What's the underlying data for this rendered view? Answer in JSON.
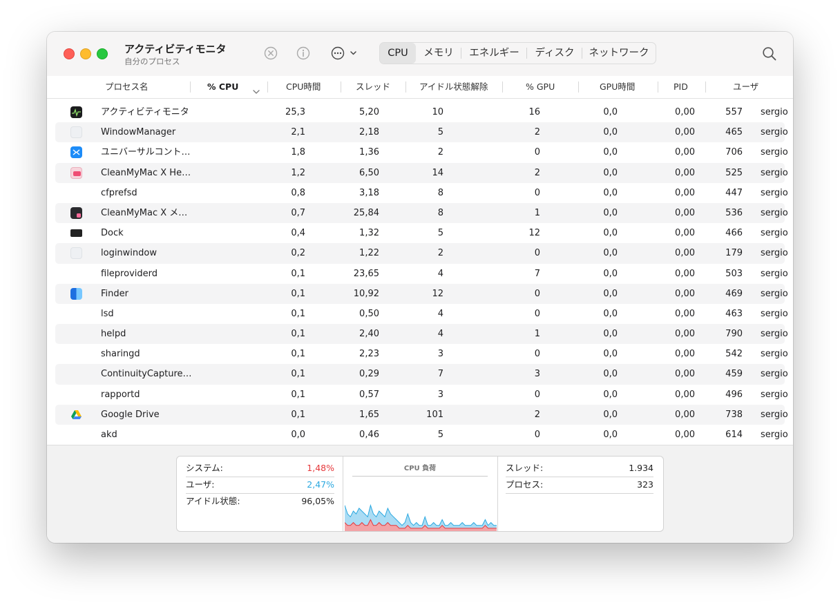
{
  "window": {
    "title": "アクティビティモニタ",
    "subtitle": "自分のプロセス"
  },
  "toolbar": {
    "icons": [
      "stop-process-icon",
      "info-icon",
      "more-actions-icon",
      "search-icon"
    ],
    "tabs": [
      {
        "label": "CPU",
        "active": true
      },
      {
        "label": "メモリ",
        "active": false
      },
      {
        "label": "エネルギー",
        "active": false
      },
      {
        "label": "ディスク",
        "active": false
      },
      {
        "label": "ネットワーク",
        "active": false
      }
    ]
  },
  "columns": [
    "プロセス名",
    "% CPU",
    "CPU時間",
    "スレッド",
    "アイドル状態解除",
    "% GPU",
    "GPU時間",
    "PID",
    "ユーザ"
  ],
  "processes": [
    {
      "name": "アクティビティモニタ",
      "icon": "activity-monitor-icon",
      "cpu": "25,3",
      "cpu_time": "5,20",
      "threads": "10",
      "idle_wakeups": "16",
      "gpu": "0,0",
      "gpu_time": "0,00",
      "pid": "557",
      "user": "sergio"
    },
    {
      "name": "WindowManager",
      "icon": "generic-app-icon",
      "cpu": "2,1",
      "cpu_time": "2,18",
      "threads": "5",
      "idle_wakeups": "2",
      "gpu": "0,0",
      "gpu_time": "0,00",
      "pid": "465",
      "user": "sergio"
    },
    {
      "name": "ユニバーサルコント…",
      "icon": "universal-control-icon",
      "cpu": "1,8",
      "cpu_time": "1,36",
      "threads": "2",
      "idle_wakeups": "0",
      "gpu": "0,0",
      "gpu_time": "0,00",
      "pid": "706",
      "user": "sergio"
    },
    {
      "name": "CleanMyMac X He…",
      "icon": "cleanmymac-health-icon",
      "cpu": "1,2",
      "cpu_time": "6,50",
      "threads": "14",
      "idle_wakeups": "2",
      "gpu": "0,0",
      "gpu_time": "0,00",
      "pid": "525",
      "user": "sergio"
    },
    {
      "name": "cfprefsd",
      "icon": "",
      "cpu": "0,8",
      "cpu_time": "3,18",
      "threads": "8",
      "idle_wakeups": "0",
      "gpu": "0,0",
      "gpu_time": "0,00",
      "pid": "447",
      "user": "sergio"
    },
    {
      "name": "CleanMyMac X メ…",
      "icon": "cleanmymac-menu-icon",
      "cpu": "0,7",
      "cpu_time": "25,84",
      "threads": "8",
      "idle_wakeups": "1",
      "gpu": "0,0",
      "gpu_time": "0,00",
      "pid": "536",
      "user": "sergio"
    },
    {
      "name": "Dock",
      "icon": "dock-icon",
      "cpu": "0,4",
      "cpu_time": "1,32",
      "threads": "5",
      "idle_wakeups": "12",
      "gpu": "0,0",
      "gpu_time": "0,00",
      "pid": "466",
      "user": "sergio"
    },
    {
      "name": "loginwindow",
      "icon": "generic-app-icon",
      "cpu": "0,2",
      "cpu_time": "1,22",
      "threads": "2",
      "idle_wakeups": "0",
      "gpu": "0,0",
      "gpu_time": "0,00",
      "pid": "179",
      "user": "sergio"
    },
    {
      "name": "fileproviderd",
      "icon": "",
      "cpu": "0,1",
      "cpu_time": "23,65",
      "threads": "4",
      "idle_wakeups": "7",
      "gpu": "0,0",
      "gpu_time": "0,00",
      "pid": "503",
      "user": "sergio"
    },
    {
      "name": "Finder",
      "icon": "finder-icon",
      "cpu": "0,1",
      "cpu_time": "10,92",
      "threads": "12",
      "idle_wakeups": "0",
      "gpu": "0,0",
      "gpu_time": "0,00",
      "pid": "469",
      "user": "sergio"
    },
    {
      "name": "lsd",
      "icon": "",
      "cpu": "0,1",
      "cpu_time": "0,50",
      "threads": "4",
      "idle_wakeups": "0",
      "gpu": "0,0",
      "gpu_time": "0,00",
      "pid": "463",
      "user": "sergio"
    },
    {
      "name": "helpd",
      "icon": "",
      "cpu": "0,1",
      "cpu_time": "2,40",
      "threads": "4",
      "idle_wakeups": "1",
      "gpu": "0,0",
      "gpu_time": "0,00",
      "pid": "790",
      "user": "sergio"
    },
    {
      "name": "sharingd",
      "icon": "",
      "cpu": "0,1",
      "cpu_time": "2,23",
      "threads": "3",
      "idle_wakeups": "0",
      "gpu": "0,0",
      "gpu_time": "0,00",
      "pid": "542",
      "user": "sergio"
    },
    {
      "name": "ContinuityCapture…",
      "icon": "",
      "cpu": "0,1",
      "cpu_time": "0,29",
      "threads": "7",
      "idle_wakeups": "3",
      "gpu": "0,0",
      "gpu_time": "0,00",
      "pid": "459",
      "user": "sergio"
    },
    {
      "name": "rapportd",
      "icon": "",
      "cpu": "0,1",
      "cpu_time": "0,57",
      "threads": "3",
      "idle_wakeups": "0",
      "gpu": "0,0",
      "gpu_time": "0,00",
      "pid": "496",
      "user": "sergio"
    },
    {
      "name": "Google Drive",
      "icon": "google-drive-icon",
      "cpu": "0,1",
      "cpu_time": "1,65",
      "threads": "101",
      "idle_wakeups": "2",
      "gpu": "0,0",
      "gpu_time": "0,00",
      "pid": "738",
      "user": "sergio"
    },
    {
      "name": "akd",
      "icon": "",
      "cpu": "0,0",
      "cpu_time": "0,46",
      "threads": "5",
      "idle_wakeups": "0",
      "gpu": "0,0",
      "gpu_time": "0,00",
      "pid": "614",
      "user": "sergio"
    }
  ],
  "summary": {
    "system_label": "システム:",
    "system_value": "1,48%",
    "user_label": "ユーザ:",
    "user_value": "2,47%",
    "idle_label": "アイドル状態:",
    "idle_value": "96,05%",
    "chart_title": "CPU 負荷",
    "threads_label": "スレッド:",
    "threads_value": "1.934",
    "processes_label": "プロセス:",
    "processes_value": "323"
  },
  "colors": {
    "system": "#e5383b",
    "user": "#2aa8e0",
    "user_fill": "#aadcf4",
    "system_fill": "#f3a3a6"
  },
  "cpu_load_history": {
    "user": [
      9,
      6,
      5,
      7,
      6,
      8,
      7,
      6,
      5,
      9,
      6,
      5,
      7,
      6,
      5,
      8,
      6,
      5,
      4,
      3,
      2,
      3,
      6,
      3,
      2,
      3,
      2,
      2,
      5,
      2,
      2,
      3,
      2,
      2,
      4,
      2,
      2,
      3,
      2,
      2,
      2,
      3,
      2,
      2,
      2,
      3,
      2,
      2,
      2,
      4,
      2,
      3,
      2,
      2
    ],
    "system": [
      3,
      2,
      2,
      3,
      2,
      2,
      3,
      2,
      2,
      4,
      2,
      2,
      3,
      2,
      2,
      3,
      2,
      2,
      2,
      1,
      1,
      1,
      2,
      1,
      1,
      1,
      1,
      1,
      2,
      1,
      1,
      1,
      1,
      1,
      2,
      1,
      1,
      1,
      1,
      1,
      1,
      1,
      1,
      1,
      1,
      1,
      1,
      1,
      1,
      2,
      1,
      1,
      1,
      1
    ]
  }
}
